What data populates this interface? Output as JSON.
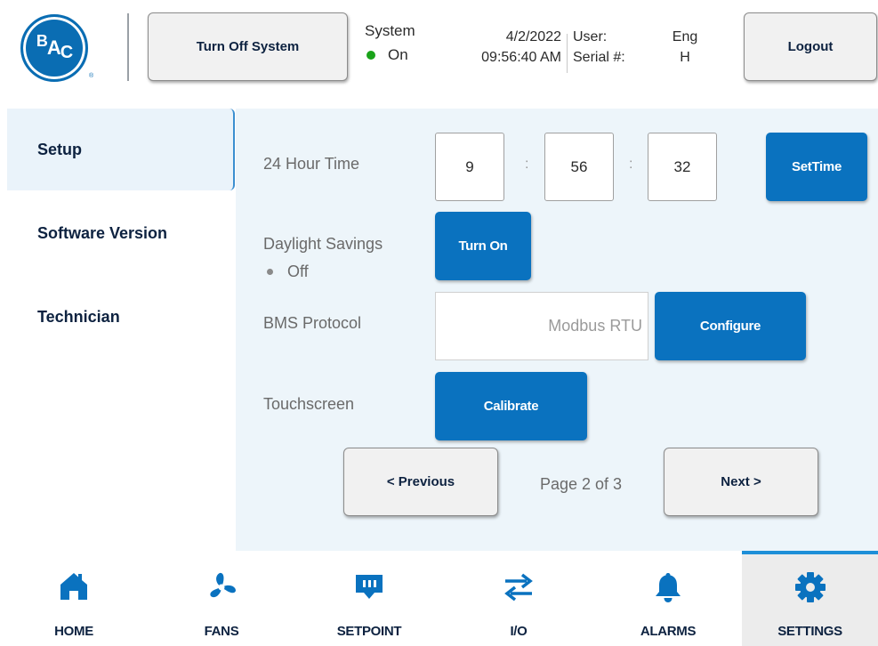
{
  "header": {
    "logo_text": "BAC",
    "logo_registered": "®",
    "turn_off_label": "Turn Off System",
    "system_label": "System",
    "system_status": "On",
    "date": "4/2/2022",
    "time": "09:56:40 AM",
    "user_label": "User:",
    "user_value": "Eng",
    "serial_label": "Serial #:",
    "serial_value": "H",
    "logout_label": "Logout"
  },
  "sidebar": {
    "items": [
      {
        "label": "Setup",
        "active": true
      },
      {
        "label": "Software Version",
        "active": false
      },
      {
        "label": "Technician",
        "active": false
      }
    ]
  },
  "main": {
    "time_row": {
      "label": "24 Hour Time",
      "hour": "9",
      "minute": "56",
      "second": "32",
      "separator": ":",
      "button": "SetTime"
    },
    "dst_row": {
      "label": "Daylight Savings",
      "status": "Off",
      "button": "Turn On"
    },
    "bms_row": {
      "label": "BMS Protocol",
      "value": "Modbus RTU",
      "button": "Configure"
    },
    "touch_row": {
      "label": "Touchscreen",
      "button": "Calibrate"
    },
    "pager": {
      "prev": "< Previous",
      "indicator": "Page 2 of 3",
      "next": "Next >"
    }
  },
  "nav": {
    "items": [
      {
        "label": "HOME",
        "icon": "home-icon"
      },
      {
        "label": "FANS",
        "icon": "fan-icon"
      },
      {
        "label": "SETPOINT",
        "icon": "setpoint-icon"
      },
      {
        "label": "I/O",
        "icon": "io-arrows-icon"
      },
      {
        "label": "ALARMS",
        "icon": "bell-icon"
      },
      {
        "label": "SETTINGS",
        "icon": "gear-icon",
        "active": true
      }
    ]
  },
  "colors": {
    "brand_blue": "#0a72bf",
    "navy_text": "#0d2240",
    "status_green": "#1aa31a",
    "active_tab_accent": "#1e8fd8",
    "panel_bg": "#edf5fa"
  }
}
